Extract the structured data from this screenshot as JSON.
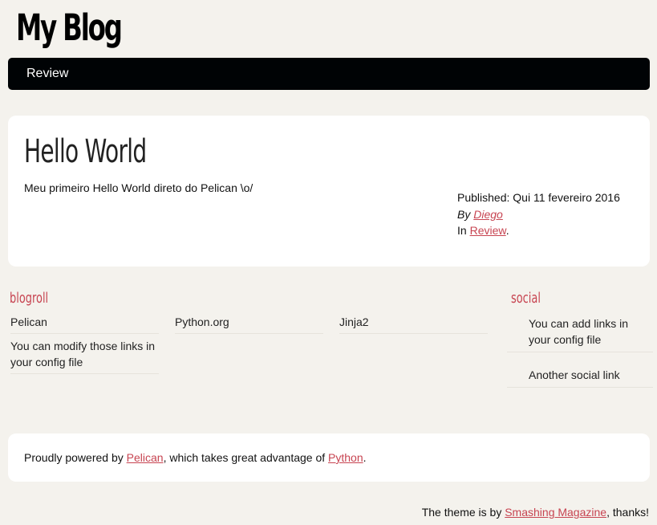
{
  "header": {
    "site_title": "My Blog"
  },
  "menu": {
    "items": [
      {
        "label": "Review"
      }
    ]
  },
  "article": {
    "title": "Hello World",
    "body": "Meu primeiro Hello World direto do Pelican \\o/",
    "published_label": "Published:",
    "published_date": "Qui 11 fevereiro 2016",
    "by_label": "By",
    "author": "Diego",
    "in_label": "In",
    "category": "Review",
    "period": "."
  },
  "blogroll": {
    "heading": "blogroll",
    "links": [
      "Pelican",
      "Python.org",
      "Jinja2",
      "You can modify those links in your config file"
    ]
  },
  "social": {
    "heading": "social",
    "links": [
      "You can add links in your config file",
      "Another social link"
    ]
  },
  "footer": {
    "prefix": "Proudly powered by",
    "pelican_link": "Pelican",
    "middle": ", which takes great advantage of",
    "python_link": "Python",
    "suffix": "."
  },
  "credit": {
    "prefix": "The theme is by",
    "link": "Smashing Magazine",
    "suffix": ", thanks!"
  },
  "colors": {
    "background": "#f4f2ed",
    "menu_bar": "#000305",
    "accent": "#c74451"
  }
}
